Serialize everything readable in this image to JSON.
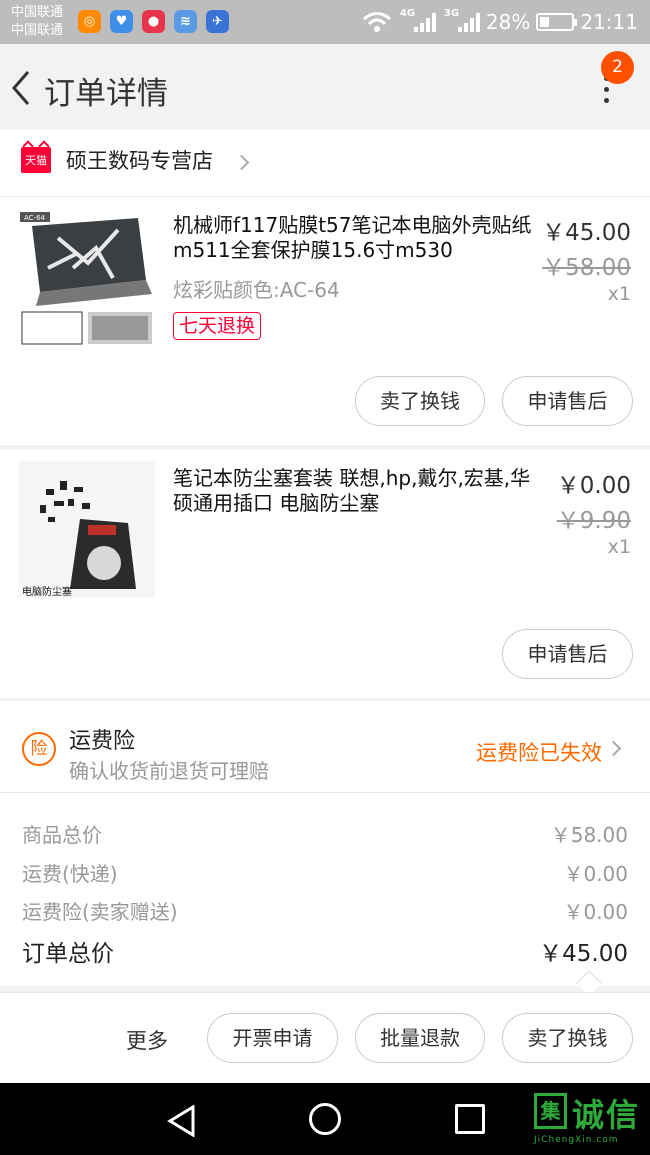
{
  "status_bar": {
    "carrier_1": "中国联通",
    "carrier_2": "中国联通",
    "net_1": "4G",
    "net_2": "3G",
    "battery": "28%",
    "battery_level": 0.28,
    "time": "21:11",
    "app_icons": [
      "uc-browser-icon",
      "health-icon",
      "chat-icon",
      "wifi-app-icon",
      "mail-icon"
    ]
  },
  "header": {
    "title": "订单详情",
    "badge_count": "2"
  },
  "shop": {
    "badge": "天猫",
    "name": "硕王数码专营店"
  },
  "items": [
    {
      "title": "机械师f117贴膜t57笔记本电脑外壳贴纸m511全套保护膜15.6寸m530",
      "spec": "炫彩贴颜色:AC-64",
      "tag": "七天退换",
      "thumb_label": "AC-64",
      "price": "￥45.00",
      "original_price": "￥58.00",
      "qty": "x1",
      "buttons": [
        "卖了换钱",
        "申请售后"
      ]
    },
    {
      "title": "笔记本防尘塞套装 联想,hp,戴尔,宏基,华硕通用插口 电脑防尘塞",
      "thumb_label": "电脑防尘塞",
      "price": "￥0.00",
      "original_price": "￥9.90",
      "qty": "x1",
      "buttons": [
        "申请售后"
      ]
    }
  ],
  "insurance": {
    "icon_text": "险",
    "title": "运费险",
    "subtitle": "确认收货前退货可理赔",
    "status": "运费险已失效"
  },
  "totals": [
    {
      "label": "商品总价",
      "value": "￥58.00"
    },
    {
      "label": "运费(快递)",
      "value": "￥0.00"
    },
    {
      "label": "运费险(卖家赠送)",
      "value": "￥0.00"
    }
  ],
  "order_total": {
    "label": "订单总价",
    "value": "￥45.00"
  },
  "actions": {
    "more": "更多",
    "invoice": "开票申请",
    "bulk_refund": "批量退款",
    "sell": "卖了换钱"
  },
  "watermark": {
    "logo": "集",
    "text": "诚信",
    "url": "JiChengXin.com"
  },
  "colors": {
    "accent": "#ff5000",
    "tmall_red": "#ff0036",
    "insurance_orange": "#ff6a00",
    "watermark_green": "#2eaa3a"
  }
}
